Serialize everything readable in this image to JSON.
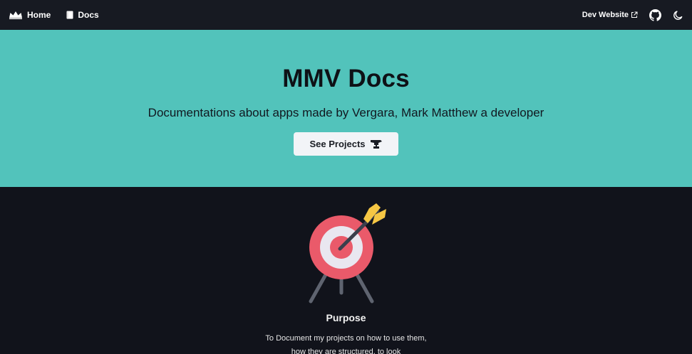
{
  "nav": {
    "home_label": "Home",
    "docs_label": "Docs",
    "dev_website_label": "Dev Website",
    "icons": {
      "home": "crown-icon",
      "docs": "book-icon",
      "external": "external-link-icon",
      "github": "github-icon",
      "theme": "moon-icon"
    }
  },
  "hero": {
    "title": "MMV Docs",
    "subtitle": "Documentations about apps made by Vergara, Mark Matthew a developer",
    "cta_label": "See Projects",
    "cta_icon": "anvil-icon",
    "background": "#52c3bb"
  },
  "feature": {
    "illustration": "target-icon",
    "title": "Purpose",
    "text": "To Document my projects on how to use them, how they are structured, to look"
  },
  "colors": {
    "nav_bg": "#171a22",
    "page_bg": "#11131b",
    "accent": "#52c3bb",
    "target_red": "#ea5a6a",
    "arrow_yellow": "#f6c744"
  }
}
